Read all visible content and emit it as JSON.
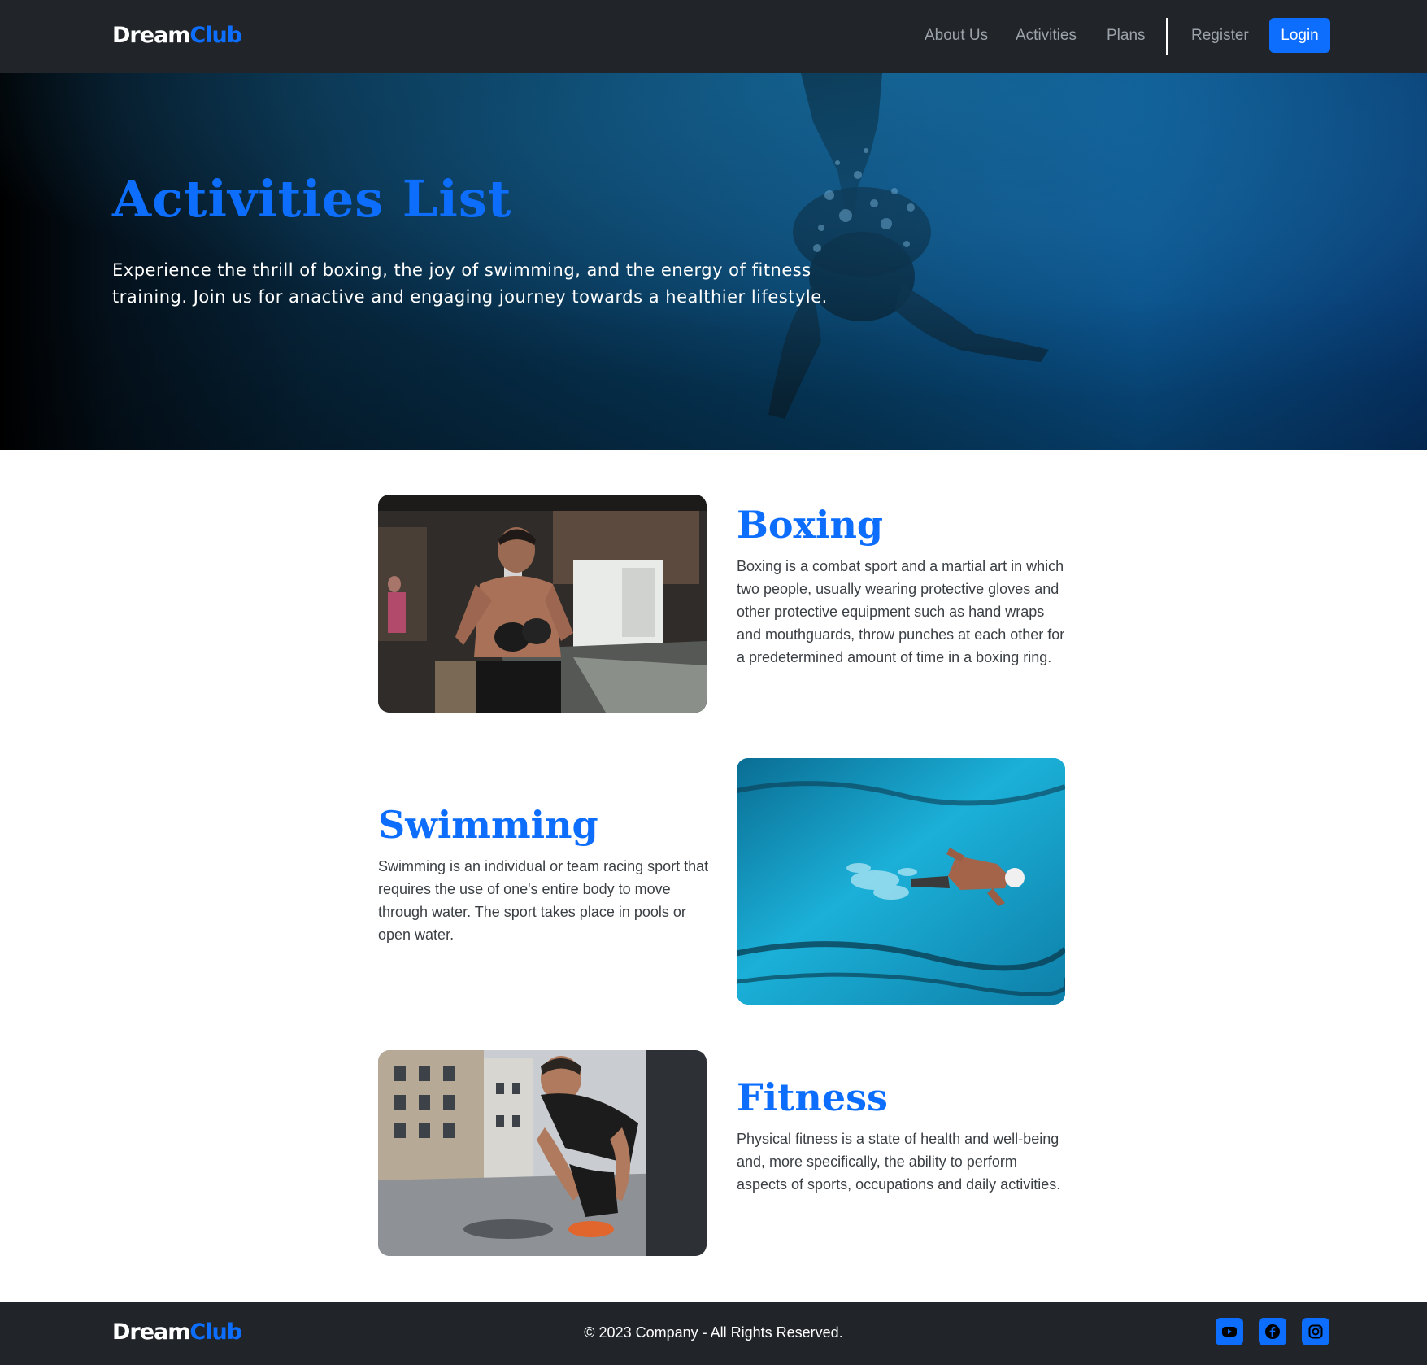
{
  "brand": {
    "part1": "Dream",
    "part2": "Club"
  },
  "nav": {
    "links": [
      "About Us",
      "Activities",
      "Plans"
    ],
    "register": "Register",
    "login": "Login"
  },
  "hero": {
    "title": "Activities List",
    "text": "Experience the thrill of boxing, the joy of swimming, and the energy of fitness training. Join us for anactive and engaging journey towards a healthier lifestyle."
  },
  "activities": [
    {
      "title": "Boxing",
      "description": "Boxing is a combat sport and a martial art in which two people, usually wearing protective gloves and other protective equipment such as hand wraps and mouthguards, throw punches at each other for a predetermined amount of time in a boxing ring."
    },
    {
      "title": "Swimming",
      "description": "Swimming is an individual or team racing sport that requires the use of one's entire body to move through water. The sport takes place in pools or open water."
    },
    {
      "title": "Fitness",
      "description": "Physical fitness is a state of health and well-being and, more specifically, the ability to perform aspects of sports, occupations and daily activities."
    }
  ],
  "footer": {
    "copyright": "© 2023 Company - All Rights Reserved.",
    "social_icons": [
      "youtube-icon",
      "facebook-icon",
      "instagram-icon"
    ]
  },
  "colors": {
    "accent": "#0d6efd",
    "dark": "#212529"
  }
}
